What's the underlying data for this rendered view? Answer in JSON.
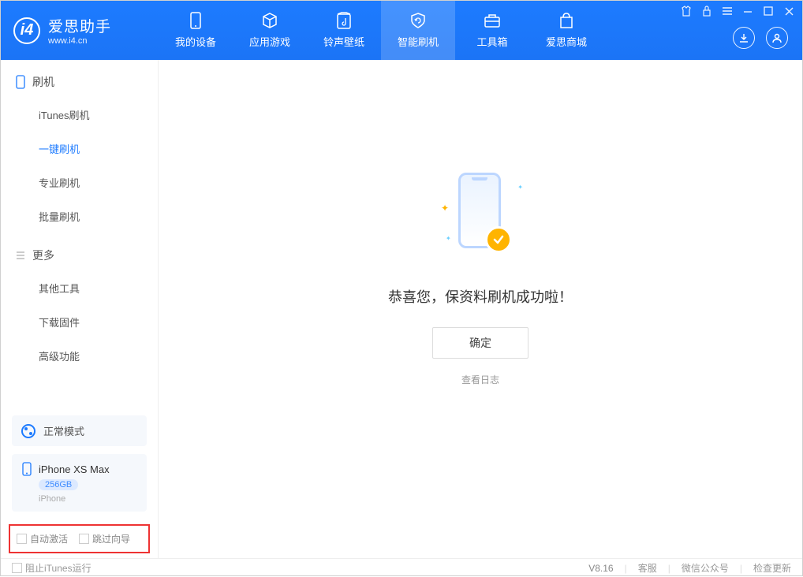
{
  "app": {
    "name_cn": "爱思助手",
    "name_en": "www.i4.cn"
  },
  "nav": [
    {
      "label": "我的设备"
    },
    {
      "label": "应用游戏"
    },
    {
      "label": "铃声壁纸"
    },
    {
      "label": "智能刷机"
    },
    {
      "label": "工具箱"
    },
    {
      "label": "爱思商城"
    }
  ],
  "sidebar": {
    "flash_title": "刷机",
    "flash_items": [
      {
        "label": "iTunes刷机"
      },
      {
        "label": "一键刷机"
      },
      {
        "label": "专业刷机"
      },
      {
        "label": "批量刷机"
      }
    ],
    "more_title": "更多",
    "more_items": [
      {
        "label": "其他工具"
      },
      {
        "label": "下载固件"
      },
      {
        "label": "高级功能"
      }
    ]
  },
  "mode": {
    "label": "正常模式"
  },
  "device": {
    "name": "iPhone XS Max",
    "storage": "256GB",
    "type": "iPhone"
  },
  "checkboxes": {
    "auto_activate": "自动激活",
    "skip_guide": "跳过向导"
  },
  "main": {
    "success_text": "恭喜您，保资料刷机成功啦！",
    "ok_button": "确定",
    "view_log": "查看日志"
  },
  "footer": {
    "block_itunes": "阻止iTunes运行",
    "version": "V8.16",
    "support": "客服",
    "wechat": "微信公众号",
    "update": "检查更新"
  }
}
